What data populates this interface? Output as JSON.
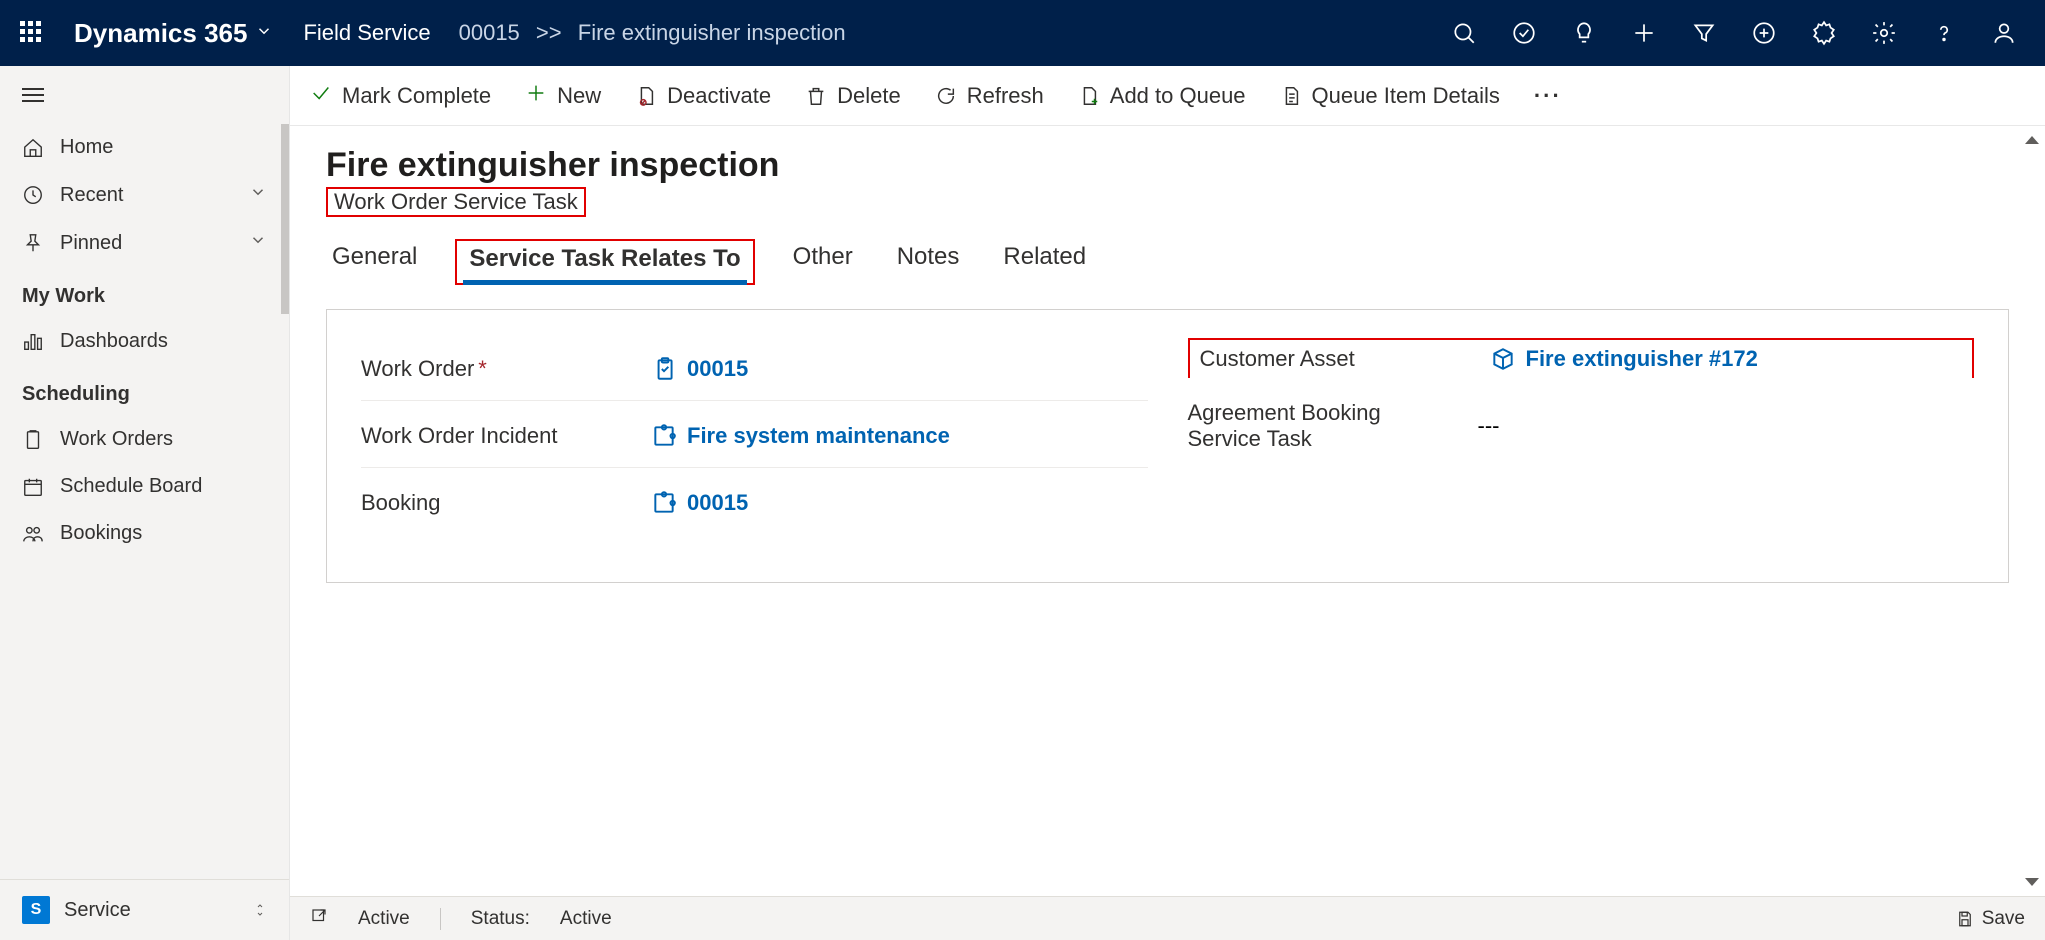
{
  "brand": "Dynamics 365",
  "app": "Field Service",
  "breadcrumb": {
    "id": "00015",
    "title": "Fire extinguisher inspection"
  },
  "sidebar": {
    "home": "Home",
    "recent": "Recent",
    "pinned": "Pinned",
    "group1": "My Work",
    "dashboards": "Dashboards",
    "group2": "Scheduling",
    "workorders": "Work Orders",
    "scheduleboard": "Schedule Board",
    "bookings": "Bookings",
    "area_letter": "S",
    "area": "Service"
  },
  "commands": {
    "mark_complete": "Mark Complete",
    "new": "New",
    "deactivate": "Deactivate",
    "delete": "Delete",
    "refresh": "Refresh",
    "add_queue": "Add to Queue",
    "queue_details": "Queue Item Details"
  },
  "record": {
    "title": "Fire extinguisher inspection",
    "subtitle": "Work Order Service Task"
  },
  "tabs": {
    "general": "General",
    "relates": "Service Task Relates To",
    "other": "Other",
    "notes": "Notes",
    "related": "Related"
  },
  "fields": {
    "work_order_label": "Work Order",
    "work_order_value": "00015",
    "incident_label": "Work Order Incident",
    "incident_value": "Fire system maintenance",
    "booking_label": "Booking",
    "booking_value": "00015",
    "asset_label": "Customer Asset",
    "asset_value": "Fire extinguisher #172",
    "agreement_label": "Agreement Booking Service Task",
    "agreement_value": "---"
  },
  "status": {
    "state": "Active",
    "status_label": "Status:",
    "status_value": "Active",
    "save": "Save"
  }
}
